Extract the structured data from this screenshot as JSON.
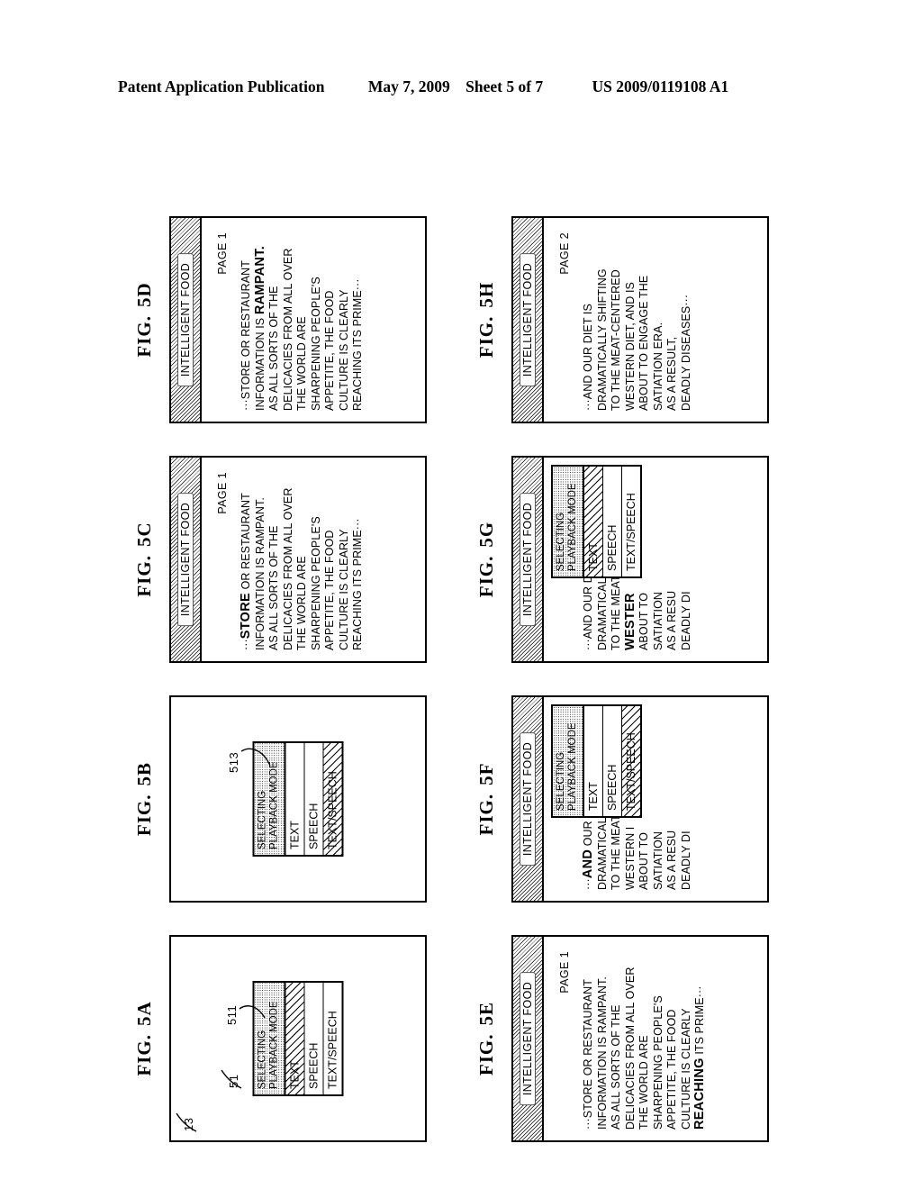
{
  "header": {
    "publication": "Patent Application Publication",
    "date": "May 7, 2009",
    "sheet": "Sheet 5 of 7",
    "docnum": "US 2009/0119108 A1"
  },
  "screen": {
    "title": "INTELLIGENT FOOD",
    "page1_label": "PAGE 1",
    "page2_label": "PAGE 2"
  },
  "menu": {
    "header_line1": "SELECTING",
    "header_line2": "PLAYBACK MODE",
    "item_text": "TEXT",
    "item_speech": "SPEECH",
    "item_text_speech": "TEXT/SPEECH"
  },
  "page1": {
    "lines": [
      "···STORE OR RESTAURANT",
      "INFORMATION IS RAMPANT.",
      "AS ALL SORTS OF THE",
      "DELICACIES FROM ALL OVER",
      "THE WORLD ARE",
      "SHARPENING PEOPLE'S",
      "APPETITE, THE FOOD",
      "CULTURE IS CLEARLY",
      "REACHING ITS PRIME···"
    ]
  },
  "page2": {
    "lines": [
      "···AND OUR DIET IS",
      "DRAMATICALLY SHIFTING",
      "TO THE MEAT-CENTERED",
      "WESTERN DIET, AND IS",
      "ABOUT TO ENGAGE THE",
      "SATIATION ERA.",
      "AS A RESULT,",
      "DEADLY DISEASES···"
    ],
    "clipped_lines": [
      "···AND OUR DIET IS",
      "DRAMATICALLY SHIFTING",
      "TO THE MEAT-CENTERED",
      "WESTERN I",
      "ABOUT TO",
      "SATIATION",
      "AS A RESU",
      "DEADLY DI"
    ],
    "clipped_lines_g": [
      "···AND OUR DIET IS",
      "DRAMATICALLY SHIFTING",
      "TO THE MEAT-CENTERED",
      "WESTER",
      "ABOUT TO",
      "SATIATION",
      "AS A RESU",
      "DEADLY DI"
    ]
  },
  "figures": [
    {
      "id": "5A",
      "label_prefix": "FIG.",
      "label_number": "5A",
      "type": "menu-only",
      "selected": "TEXT",
      "refs": [
        {
          "num": "13"
        },
        {
          "num": "51"
        },
        {
          "num": "511"
        }
      ]
    },
    {
      "id": "5B",
      "label_prefix": "FIG.",
      "label_number": "5B",
      "type": "menu-only",
      "selected": "TEXT/SPEECH",
      "refs": [
        {
          "num": "513"
        }
      ]
    },
    {
      "id": "5C",
      "label_prefix": "FIG.",
      "label_number": "5C",
      "type": "page",
      "page": "1",
      "bold_word": "STORE",
      "bold_line_index": 0
    },
    {
      "id": "5D",
      "label_prefix": "FIG.",
      "label_number": "5D",
      "type": "page",
      "page": "1",
      "bold_word": "RAMPANT.",
      "bold_line_index": 1
    },
    {
      "id": "5E",
      "label_prefix": "FIG.",
      "label_number": "5E",
      "type": "page",
      "page": "1",
      "bold_word": "REACHING",
      "bold_line_index": 8
    },
    {
      "id": "5F",
      "label_prefix": "FIG.",
      "label_number": "5F",
      "type": "page-menu",
      "page": "2",
      "bold_word": "AND",
      "bold_line_index": 0,
      "selected": "TEXT/SPEECH"
    },
    {
      "id": "5G",
      "label_prefix": "FIG.",
      "label_number": "5G",
      "type": "page-menu",
      "page": "2",
      "bold_word": "WESTER",
      "bold_line_index": 3,
      "selected": "TEXT"
    },
    {
      "id": "5H",
      "label_prefix": "FIG.",
      "label_number": "5H",
      "type": "page",
      "page": "2",
      "bold_word": "",
      "bold_line_index": -1
    }
  ]
}
